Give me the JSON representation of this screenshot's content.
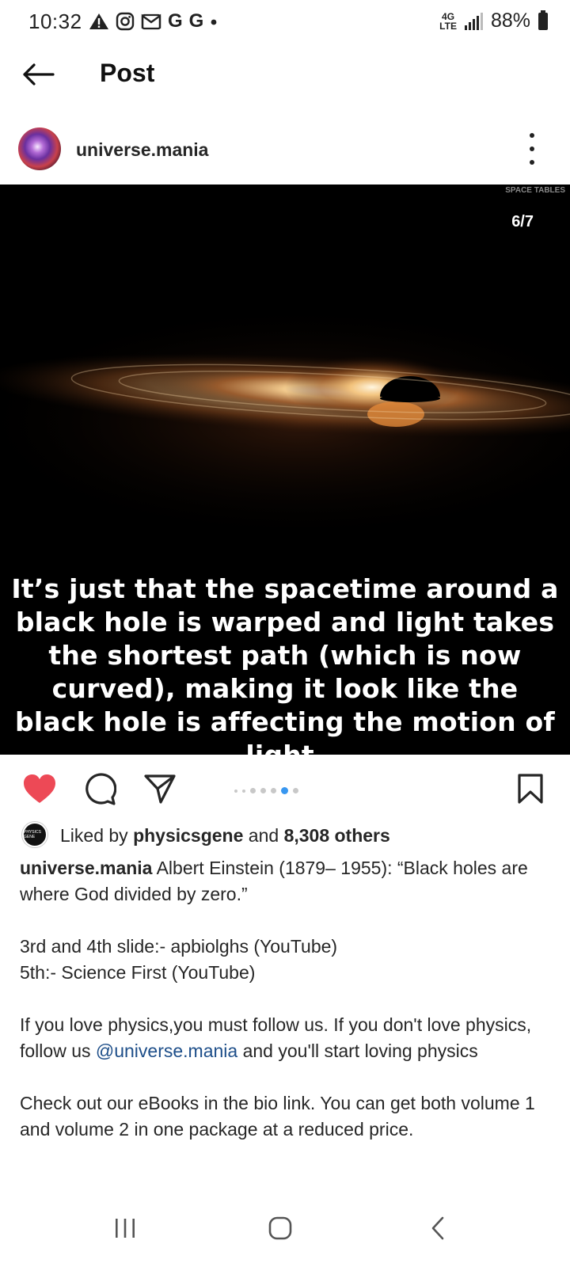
{
  "status_bar": {
    "time": "10:32",
    "notification_icons": [
      "warning-icon",
      "instagram-icon",
      "gmail-icon",
      "google-icon",
      "google-icon",
      "dot-icon"
    ],
    "network": "4G LTE",
    "battery": "88%"
  },
  "header": {
    "title": "Post"
  },
  "post": {
    "author": "universe.mania",
    "slide_counter": "6/7",
    "watermark": "SPACE TABLES",
    "overlay_text": "It’s  just that the spacetime around a black hole is warped and light takes the shortest path (which is now curved), making it look like the black hole is affecting the motion of light.",
    "carousel": {
      "total_dots": 7,
      "active_index": 5
    }
  },
  "likes": {
    "prefix": "Liked by ",
    "liker": "physicsgene",
    "middle": " and ",
    "others": "8,308 others",
    "liker_avatar_text": "PHYSICS GENE"
  },
  "caption": {
    "user": "universe.mania",
    "line1": " Albert Einstein (1879– 1955): “Black holes are where God divided by zero.”",
    "line2": "3rd and 4th slide:- apbiolghs (YouTube)",
    "line3": "5th:- Science First (YouTube)",
    "line4_a": "If you love physics,you must follow us. If you don't love physics, follow us ",
    "line4_mention": "@universe.mania",
    "line4_b": " and you'll start loving physics",
    "line5": "Check out our eBooks in the bio link. You can get both volume 1 and volume 2 in one package at a reduced price."
  },
  "colors": {
    "like_red": "#ed4956",
    "mention_blue": "#1d4e89",
    "active_dot": "#3897f0"
  }
}
